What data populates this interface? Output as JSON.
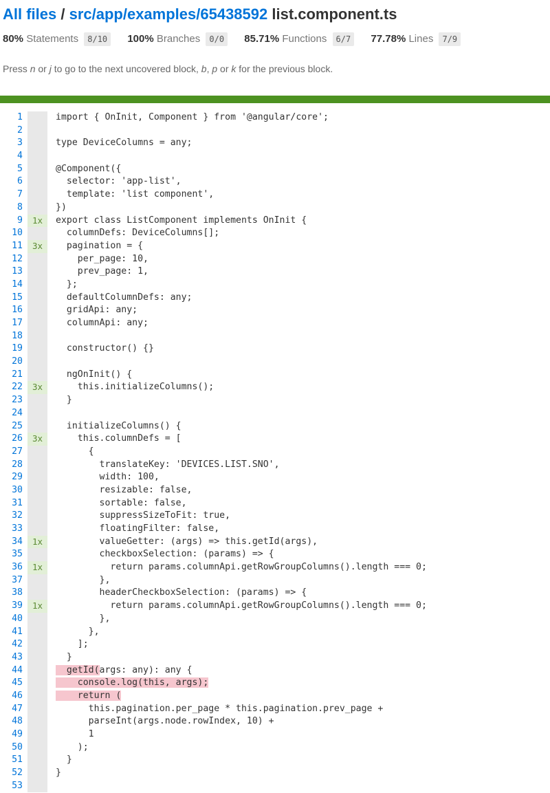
{
  "header": {
    "all_files": "All files",
    "separator": " / ",
    "path": "src/app/examples/65438592",
    "filename": " list.component.ts"
  },
  "stats": [
    {
      "pct": "80%",
      "label": "Statements",
      "frac": "8/10"
    },
    {
      "pct": "100%",
      "label": "Branches",
      "frac": "0/0"
    },
    {
      "pct": "85.71%",
      "label": "Functions",
      "frac": "6/7"
    },
    {
      "pct": "77.78%",
      "label": "Lines",
      "frac": "7/9"
    }
  ],
  "hint": "Press n or j to go to the next uncovered block, b, p or k for the previous block.",
  "colors": {
    "status_bar": "#4d9221",
    "link": "#0074D9",
    "uncovered": "#f6c6ce",
    "covered_hit": "#e2efd7"
  },
  "lines": [
    {
      "n": "1",
      "hit": "",
      "src": "import { OnInit, Component } from '@angular/core';"
    },
    {
      "n": "2",
      "hit": "",
      "src": ""
    },
    {
      "n": "3",
      "hit": "",
      "src": "type DeviceColumns = any;"
    },
    {
      "n": "4",
      "hit": "",
      "src": ""
    },
    {
      "n": "5",
      "hit": "",
      "src": "@Component({"
    },
    {
      "n": "6",
      "hit": "",
      "src": "  selector: 'app-list',"
    },
    {
      "n": "7",
      "hit": "",
      "src": "  template: 'list component',"
    },
    {
      "n": "8",
      "hit": "",
      "src": "})"
    },
    {
      "n": "9",
      "hit": "1x",
      "src": "export class ListComponent implements OnInit {"
    },
    {
      "n": "10",
      "hit": "",
      "src": "  columnDefs: DeviceColumns[];"
    },
    {
      "n": "11",
      "hit": "3x",
      "src": "  pagination = {"
    },
    {
      "n": "12",
      "hit": "",
      "src": "    per_page: 10,"
    },
    {
      "n": "13",
      "hit": "",
      "src": "    prev_page: 1,"
    },
    {
      "n": "14",
      "hit": "",
      "src": "  };"
    },
    {
      "n": "15",
      "hit": "",
      "src": "  defaultColumnDefs: any;"
    },
    {
      "n": "16",
      "hit": "",
      "src": "  gridApi: any;"
    },
    {
      "n": "17",
      "hit": "",
      "src": "  columnApi: any;"
    },
    {
      "n": "18",
      "hit": "",
      "src": ""
    },
    {
      "n": "19",
      "hit": "",
      "src": "  constructor() {}"
    },
    {
      "n": "20",
      "hit": "",
      "src": ""
    },
    {
      "n": "21",
      "hit": "",
      "src": "  ngOnInit() {"
    },
    {
      "n": "22",
      "hit": "3x",
      "src": "    this.initializeColumns();"
    },
    {
      "n": "23",
      "hit": "",
      "src": "  }"
    },
    {
      "n": "24",
      "hit": "",
      "src": ""
    },
    {
      "n": "25",
      "hit": "",
      "src": "  initializeColumns() {"
    },
    {
      "n": "26",
      "hit": "3x",
      "src": "    this.columnDefs = ["
    },
    {
      "n": "27",
      "hit": "",
      "src": "      {"
    },
    {
      "n": "28",
      "hit": "",
      "src": "        translateKey: 'DEVICES.LIST.SNO',"
    },
    {
      "n": "29",
      "hit": "",
      "src": "        width: 100,"
    },
    {
      "n": "30",
      "hit": "",
      "src": "        resizable: false,"
    },
    {
      "n": "31",
      "hit": "",
      "src": "        sortable: false,"
    },
    {
      "n": "32",
      "hit": "",
      "src": "        suppressSizeToFit: true,"
    },
    {
      "n": "33",
      "hit": "",
      "src": "        floatingFilter: false,"
    },
    {
      "n": "34",
      "hit": "1x",
      "src": "        valueGetter: (args) => this.getId(args),"
    },
    {
      "n": "35",
      "hit": "",
      "src": "        checkboxSelection: (params) => {"
    },
    {
      "n": "36",
      "hit": "1x",
      "src": "          return params.columnApi.getRowGroupColumns().length === 0;"
    },
    {
      "n": "37",
      "hit": "",
      "src": "        },"
    },
    {
      "n": "38",
      "hit": "",
      "src": "        headerCheckboxSelection: (params) => {"
    },
    {
      "n": "39",
      "hit": "1x",
      "src": "          return params.columnApi.getRowGroupColumns().length === 0;"
    },
    {
      "n": "40",
      "hit": "",
      "src": "        },"
    },
    {
      "n": "41",
      "hit": "",
      "src": "      },"
    },
    {
      "n": "42",
      "hit": "",
      "src": "    ];"
    },
    {
      "n": "43",
      "hit": "",
      "src": "  }"
    },
    {
      "n": "44",
      "hit": "",
      "src": "  getId(args: any): any {",
      "miss": "  getId("
    },
    {
      "n": "45",
      "hit": "",
      "src": "    console.log(this, args);",
      "miss": "    console.log(this, args);"
    },
    {
      "n": "46",
      "hit": "",
      "src": "    return (",
      "miss": "    return ("
    },
    {
      "n": "47",
      "hit": "",
      "src": "      this.pagination.per_page * this.pagination.prev_page +"
    },
    {
      "n": "48",
      "hit": "",
      "src": "      parseInt(args.node.rowIndex, 10) +"
    },
    {
      "n": "49",
      "hit": "",
      "src": "      1"
    },
    {
      "n": "50",
      "hit": "",
      "src": "    );"
    },
    {
      "n": "51",
      "hit": "",
      "src": "  }"
    },
    {
      "n": "52",
      "hit": "",
      "src": "}"
    },
    {
      "n": "53",
      "hit": "",
      "src": ""
    }
  ]
}
